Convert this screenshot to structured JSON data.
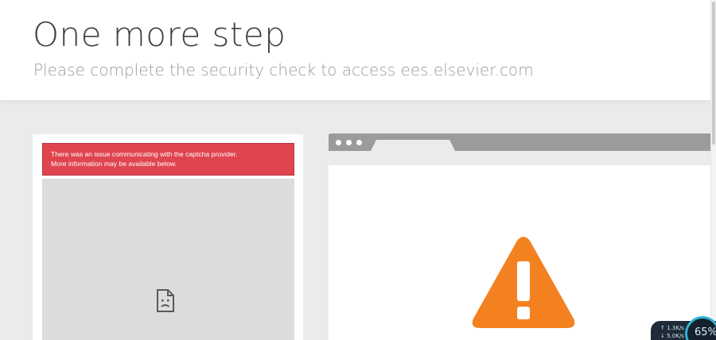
{
  "header": {
    "title": "One more step",
    "subtitle": "Please complete the security check to access ees.elsevier.com"
  },
  "captcha": {
    "error_line1": "There was an issue communicating with the captcha provider.",
    "error_line2": "More information may be available below.",
    "frame_icon": "sad-document-icon"
  },
  "illustration": {
    "icon": "warning-triangle-icon",
    "warning_color": "#f48120"
  },
  "network_widget": {
    "upload": "1.3K/s",
    "download": "5.0K/s",
    "percent": "65%"
  },
  "colors": {
    "error_bg": "#e0454f",
    "page_bg": "#ebebeb",
    "browser_chrome": "#9b9b9b"
  }
}
